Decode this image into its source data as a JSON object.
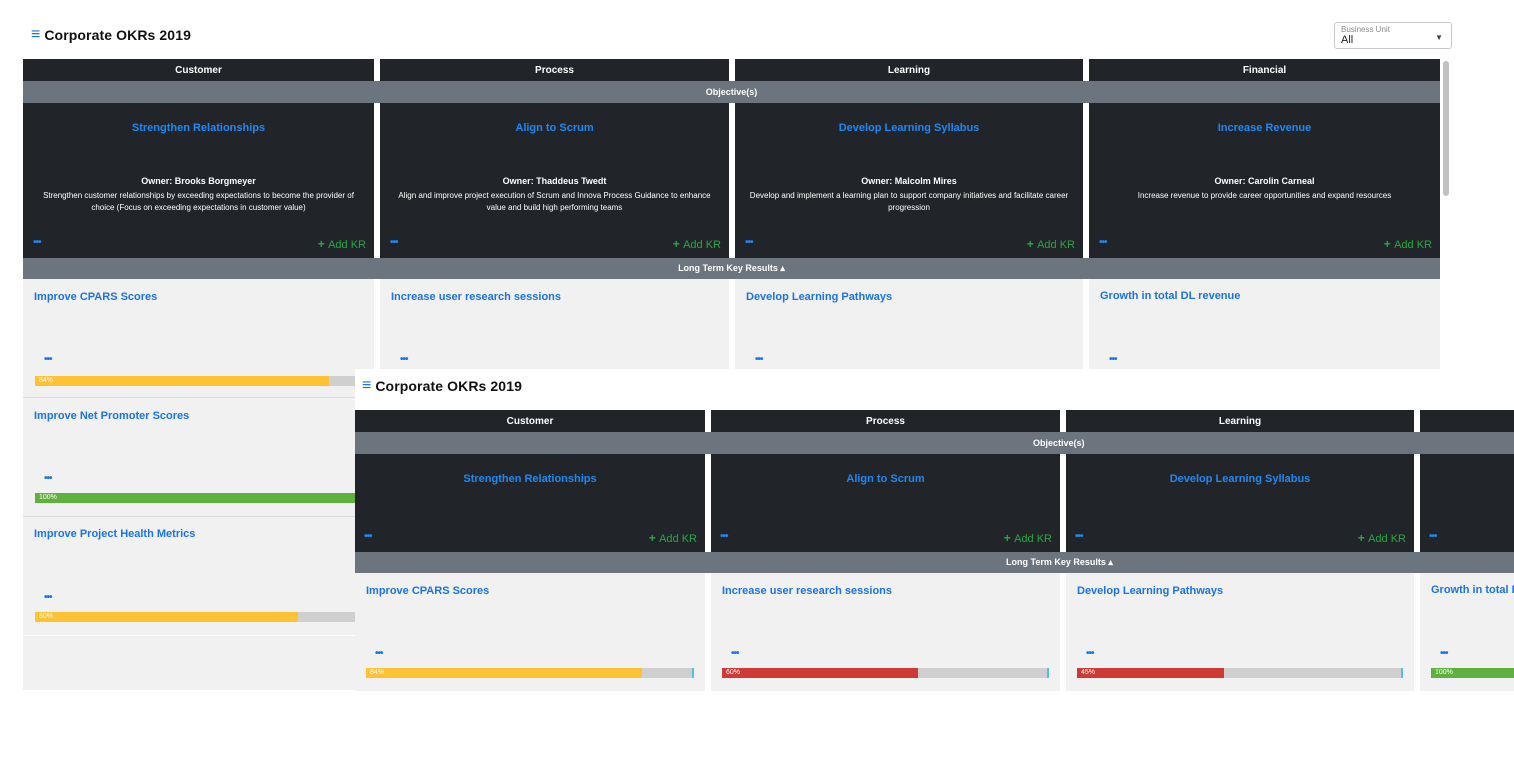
{
  "back": {
    "title": "Corporate OKRs 2019",
    "business_unit": {
      "label": "Business Unit",
      "value": "All"
    },
    "columns": [
      "Customer",
      "Process",
      "Learning",
      "Financial"
    ],
    "objectives_band": "Objective(s)",
    "long_term_band": "Long Term Key Results ▴",
    "objectives": [
      {
        "title": "Strengthen Relationships",
        "owner": "Owner: Brooks Borgmeyer",
        "desc": "Strengthen customer relationships by exceeding expectations to become the provider of choice (Focus on exceeding expectations in customer value)"
      },
      {
        "title": "Align to Scrum",
        "owner": "Owner: Thaddeus Twedt",
        "desc": "Align and improve project execution of Scrum and Innova Process Guidance to enhance value and build high performing teams"
      },
      {
        "title": "Develop Learning Syllabus",
        "owner": "Owner: Malcolm Mires",
        "desc": "Develop and implement a learning plan to support company initiatives and facilitate career progression"
      },
      {
        "title": "Increase Revenue",
        "owner": "Owner: Carolin Carneal",
        "desc": "Increase revenue to provide career opportunities and expand resources"
      }
    ],
    "add_kr": "Add KR",
    "dots": "•••",
    "key_results_row1": [
      "Improve CPARS Scores",
      "Increase user research sessions",
      "Develop Learning Pathways",
      "Growth in total DL revenue"
    ],
    "customer_krs": [
      {
        "title": "Improve CPARS Scores",
        "pct_label": "84%",
        "progress": 0.84,
        "color": "yellow"
      },
      {
        "title": "Improve Net Promoter Scores",
        "pct_label": "100%",
        "progress": 1.0,
        "color": "green"
      },
      {
        "title": "Improve Project Health Metrics",
        "pct_label": "80%",
        "progress": 0.8,
        "color": "yellow"
      }
    ]
  },
  "front": {
    "title": "Corporate OKRs 2019",
    "columns": [
      "Customer",
      "Process",
      "Learning"
    ],
    "objectives_band": "Objective(s)",
    "long_term_band": "Long Term Key Results ▴",
    "objectives": [
      "Strengthen Relationships",
      "Align to Scrum",
      "Develop Learning Syllabus"
    ],
    "add_kr": "Add KR",
    "dots": "•••",
    "krs": [
      {
        "title": "Improve CPARS Scores",
        "pct_label": "84%",
        "progress": 0.84,
        "color": "yellow"
      },
      {
        "title": "Increase user research sessions",
        "pct_label": "60%",
        "progress": 0.6,
        "color": "red"
      },
      {
        "title": "Develop Learning Pathways",
        "pct_label": "45%",
        "progress": 0.45,
        "color": "red"
      },
      {
        "title": "Growth in total DL revenue",
        "pct_label": "100%",
        "progress": 1.0,
        "color": "green"
      }
    ]
  },
  "colors": {
    "dark": "#212529",
    "band": "#6c757d",
    "link": "#1e88f5",
    "add": "#28a745",
    "yellow": "#ffc234",
    "green": "#5fb13d",
    "red": "#cf3a37"
  }
}
